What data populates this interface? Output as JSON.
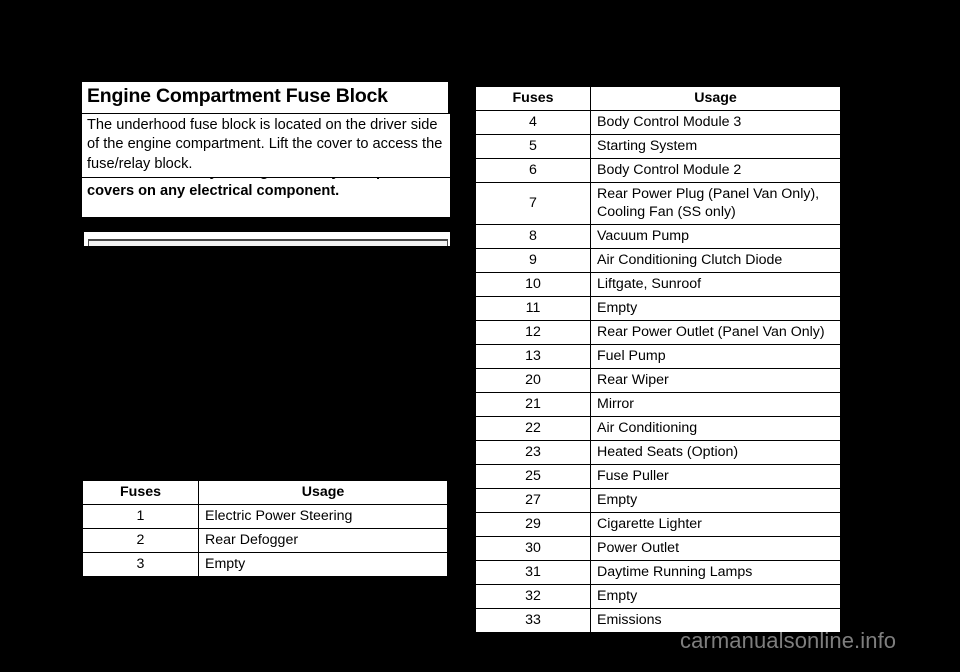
{
  "page": {
    "background_color": "#000000",
    "content_color": "#ffffff"
  },
  "left_column": {
    "section_title": "Engine Compartment Fuse Block",
    "intro_paragraph": "The underhood fuse block is located on the driver side of the engine compartment. Lift the cover to access the fuse/relay block.",
    "caution_text": "on the vehicle may damage it. Always keep the\ncovers on any electrical component."
  },
  "left_table": {
    "headers": [
      "Fuses",
      "Usage"
    ],
    "rows": [
      {
        "fuse": "1",
        "usage": "Electric Power Steering"
      },
      {
        "fuse": "2",
        "usage": "Rear Defogger"
      },
      {
        "fuse": "3",
        "usage": "Empty"
      }
    ]
  },
  "right_table": {
    "headers": [
      "Fuses",
      "Usage"
    ],
    "rows": [
      {
        "fuse": "4",
        "usage": "Body Control Module 3"
      },
      {
        "fuse": "5",
        "usage": "Starting System"
      },
      {
        "fuse": "6",
        "usage": "Body Control Module 2"
      },
      {
        "fuse": "7",
        "usage": "Rear Power Plug (Panel Van Only),\nCooling Fan (SS only)"
      },
      {
        "fuse": "8",
        "usage": "Vacuum Pump"
      },
      {
        "fuse": "9",
        "usage": "Air Conditioning Clutch Diode"
      },
      {
        "fuse": "10",
        "usage": "Liftgate, Sunroof"
      },
      {
        "fuse": "11",
        "usage": "Empty"
      },
      {
        "fuse": "12",
        "usage": "Rear Power Outlet (Panel Van Only)"
      },
      {
        "fuse": "13",
        "usage": "Fuel Pump"
      },
      {
        "fuse": "20",
        "usage": "Rear Wiper"
      },
      {
        "fuse": "21",
        "usage": "Mirror"
      },
      {
        "fuse": "22",
        "usage": "Air Conditioning"
      },
      {
        "fuse": "23",
        "usage": "Heated Seats (Option)"
      },
      {
        "fuse": "25",
        "usage": "Fuse Puller"
      },
      {
        "fuse": "27",
        "usage": "Empty"
      },
      {
        "fuse": "29",
        "usage": "Cigarette Lighter"
      },
      {
        "fuse": "30",
        "usage": "Power Outlet"
      },
      {
        "fuse": "31",
        "usage": "Daytime Running Lamps"
      },
      {
        "fuse": "32",
        "usage": "Empty"
      },
      {
        "fuse": "33",
        "usage": "Emissions"
      }
    ]
  },
  "watermark": {
    "text": "carmanualsonline.info",
    "color": "#7e7e7e"
  }
}
